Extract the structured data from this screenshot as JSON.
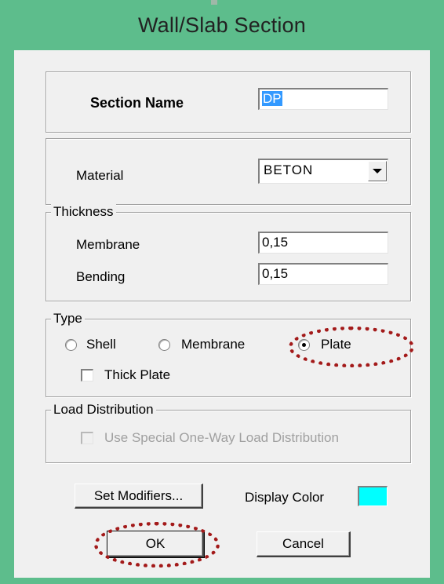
{
  "window": {
    "title": "Wall/Slab Section"
  },
  "section": {
    "label": "Section Name",
    "value": "DP"
  },
  "material": {
    "label": "Material",
    "selected": "BETON"
  },
  "thickness": {
    "legend": "Thickness",
    "membrane_label": "Membrane",
    "membrane_value": "0,15",
    "bending_label": "Bending",
    "bending_value": "0,15"
  },
  "type": {
    "legend": "Type",
    "options": [
      {
        "label": "Shell",
        "selected": false
      },
      {
        "label": "Membrane",
        "selected": false
      },
      {
        "label": "Plate",
        "selected": true
      }
    ],
    "thick_plate_label": "Thick Plate",
    "thick_plate_checked": false
  },
  "load_distribution": {
    "legend": "Load Distribution",
    "one_way_label": "Use Special One-Way Load Distribution",
    "enabled": false
  },
  "buttons": {
    "set_modifiers": "Set Modifiers...",
    "display_color_label": "Display Color",
    "display_color": "#00ffff",
    "ok": "OK",
    "cancel": "Cancel"
  },
  "annotation_color": "#a31a1a"
}
